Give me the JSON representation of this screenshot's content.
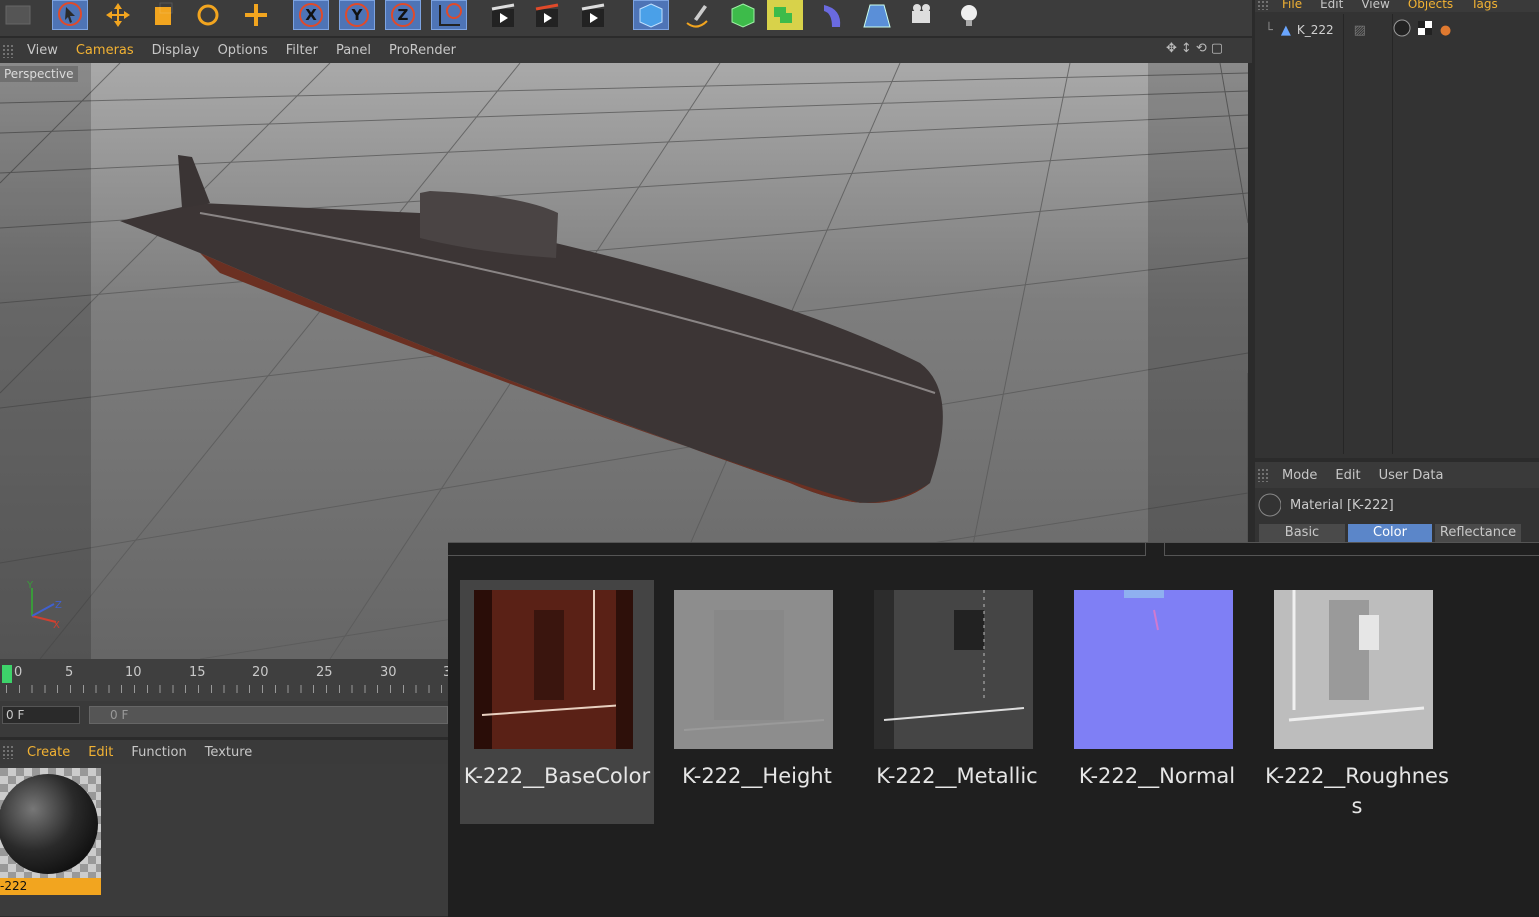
{
  "toolbar": {
    "icons": [
      "select-arrow-icon",
      "move-icon",
      "scale-icon",
      "rotate-icon",
      "transform-icon",
      "x-axis-icon",
      "y-axis-icon",
      "z-axis-icon",
      "world-coords-icon",
      "render-view-icon",
      "render-picture-icon",
      "render-settings-icon",
      "cube-icon",
      "pen-icon",
      "subdivision-icon",
      "array-icon",
      "deformer-icon",
      "floor-icon",
      "camera-icon",
      "light-icon"
    ],
    "axis_x": "X",
    "axis_y": "Y",
    "axis_z": "Z"
  },
  "viewport": {
    "menu": [
      "View",
      "Cameras",
      "Display",
      "Options",
      "Filter",
      "Panel",
      "ProRender"
    ],
    "active_menu": "Cameras",
    "label": "Perspective",
    "axis_x": "X",
    "axis_y": "Y",
    "axis_z": "Z"
  },
  "object_manager": {
    "menu": [
      "File",
      "Edit",
      "View",
      "Objects",
      "Tags"
    ],
    "object_name": "K_222"
  },
  "attributes": {
    "menu": [
      "Mode",
      "Edit",
      "User Data"
    ],
    "title": "Material [K-222]",
    "tabs": [
      "Basic",
      "Color",
      "Reflectance"
    ],
    "active_tab": "Color"
  },
  "timeline": {
    "ticks": [
      "0",
      "5",
      "10",
      "15",
      "20",
      "25",
      "30",
      "3"
    ],
    "current_frame": "0 F",
    "field_value": "0 F"
  },
  "material_manager": {
    "menu": [
      "Create",
      "Edit",
      "Function",
      "Texture"
    ],
    "material_label": "-222"
  },
  "popup": {
    "textures": [
      {
        "label": "K-222__BaseColor",
        "selected": true
      },
      {
        "label": "K-222__Height",
        "selected": false
      },
      {
        "label": "K-222__Metallic",
        "selected": false
      },
      {
        "label": "K-222__Normal",
        "selected": false
      },
      {
        "label": "K-222__Roughness",
        "selected": false
      }
    ]
  },
  "colors": {
    "accent": "#f2b233",
    "active_tab": "#5b86c9",
    "normal_map": "#7f7ff5"
  }
}
